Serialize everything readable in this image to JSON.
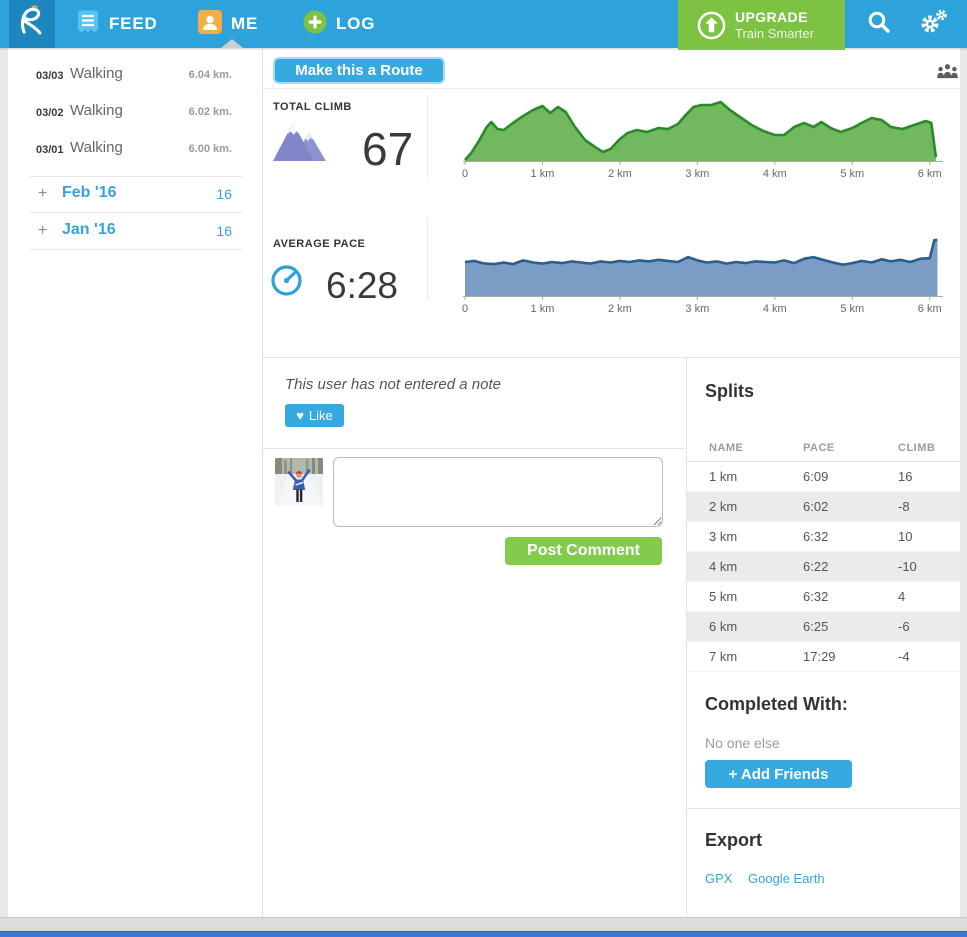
{
  "nav": {
    "brand": "R",
    "items": [
      {
        "label": "FEED",
        "icon": "feed-list-icon"
      },
      {
        "label": "ME",
        "icon": "me-person-icon",
        "active": true
      },
      {
        "label": "LOG",
        "icon": "log-plus-icon"
      }
    ],
    "upgrade": {
      "label": "UPGRADE",
      "sublabel": "Train Smarter"
    }
  },
  "sidebar": {
    "activities": [
      {
        "date": "03/03",
        "type": "Walking",
        "distance": "6.04 km."
      },
      {
        "date": "03/02",
        "type": "Walking",
        "distance": "6.02 km."
      },
      {
        "date": "03/01",
        "type": "Walking",
        "distance": "6.00 km."
      }
    ],
    "months": [
      {
        "expander": "+",
        "label": "Feb '16",
        "count": "16"
      },
      {
        "expander": "+",
        "label": "Jan '16",
        "count": "16"
      }
    ]
  },
  "main": {
    "route_button": "Make this a Route",
    "stats": [
      {
        "label": "TOTAL CLIMB",
        "value": "67"
      },
      {
        "label": "AVERAGE PACE",
        "value": "6:28"
      }
    ],
    "note": "This user has not entered a note",
    "like_button": {
      "heart": "♥",
      "label": "Like"
    },
    "post_comment_button": "Post Comment"
  },
  "splits": {
    "title": "Splits",
    "columns": [
      "NAME",
      "PACE",
      "CLIMB"
    ],
    "rows": [
      [
        "1 km",
        "6:09",
        "16"
      ],
      [
        "2 km",
        "6:02",
        "-8"
      ],
      [
        "3 km",
        "6:32",
        "10"
      ],
      [
        "4 km",
        "6:22",
        "-10"
      ],
      [
        "5 km",
        "6:32",
        "4"
      ],
      [
        "6 km",
        "6:25",
        "-6"
      ],
      [
        "7 km",
        "17:29",
        "-4"
      ]
    ]
  },
  "completed_with": {
    "title": "Completed With:",
    "empty": "No one else",
    "add_button": "+ Add Friends"
  },
  "export": {
    "title": "Export",
    "links": [
      "GPX",
      "Google Earth"
    ]
  },
  "chart_data": [
    {
      "type": "area",
      "name": "elevation-profile",
      "title": "TOTAL CLIMB 67",
      "x_ticks": [
        "0",
        "1 km",
        "2 km",
        "3 km",
        "4 km",
        "5 km",
        "6 km"
      ],
      "x_tick_km": [
        0,
        1,
        2,
        3,
        4,
        5,
        6
      ],
      "xlim_km": [
        0,
        6.12
      ],
      "x_km": [
        0.0,
        0.08,
        0.18,
        0.28,
        0.34,
        0.42,
        0.5,
        0.62,
        0.75,
        0.88,
        1.0,
        1.1,
        1.2,
        1.3,
        1.42,
        1.55,
        1.68,
        1.78,
        1.88,
        2.0,
        2.1,
        2.22,
        2.35,
        2.5,
        2.62,
        2.75,
        2.85,
        2.95,
        3.05,
        3.18,
        3.3,
        3.42,
        3.55,
        3.7,
        3.85,
        4.0,
        4.12,
        4.25,
        4.38,
        4.5,
        4.6,
        4.72,
        4.85,
        5.0,
        5.12,
        5.25,
        5.38,
        5.5,
        5.65,
        5.8,
        5.95,
        6.02,
        6.08
      ],
      "elevation_m": [
        1,
        8,
        20,
        34,
        39,
        32,
        31,
        38,
        45,
        51,
        55,
        48,
        54,
        49,
        34,
        21,
        14,
        9,
        12,
        22,
        28,
        31,
        29,
        33,
        32,
        37,
        46,
        54,
        56,
        56,
        59,
        51,
        44,
        36,
        30,
        26,
        26,
        34,
        38,
        34,
        39,
        33,
        29,
        33,
        38,
        43,
        41,
        34,
        32,
        36,
        40,
        38,
        4
      ],
      "fill": "#72B85E",
      "stroke": "#2B8A2B"
    },
    {
      "type": "area",
      "name": "pace-chart",
      "title": "AVERAGE PACE 6:28",
      "x_ticks": [
        "0",
        "1 km",
        "2 km",
        "3 km",
        "4 km",
        "5 km",
        "6 km"
      ],
      "x_tick_km": [
        0,
        1,
        2,
        3,
        4,
        5,
        6
      ],
      "xlim_km": [
        0,
        6.12
      ],
      "x_km": [
        0.0,
        0.12,
        0.25,
        0.38,
        0.5,
        0.62,
        0.75,
        0.88,
        1.0,
        1.12,
        1.25,
        1.38,
        1.5,
        1.62,
        1.75,
        1.88,
        2.0,
        2.12,
        2.25,
        2.38,
        2.5,
        2.62,
        2.75,
        2.88,
        3.0,
        3.12,
        3.25,
        3.38,
        3.5,
        3.62,
        3.75,
        3.88,
        4.0,
        4.12,
        4.25,
        4.38,
        4.5,
        4.62,
        4.75,
        4.88,
        5.0,
        5.12,
        5.25,
        5.38,
        5.5,
        5.62,
        5.75,
        5.88,
        6.0,
        6.06,
        6.1
      ],
      "pace_min_per_km": [
        6.3,
        6.5,
        6.0,
        5.9,
        6.2,
        5.9,
        6.6,
        6.2,
        6.0,
        6.3,
        6.1,
        6.4,
        6.2,
        6.0,
        6.4,
        6.2,
        6.5,
        6.3,
        6.6,
        6.4,
        6.7,
        6.5,
        6.3,
        7.2,
        6.6,
        6.2,
        6.4,
        6.0,
        6.3,
        6.1,
        6.4,
        6.3,
        6.2,
        6.6,
        6.1,
        6.9,
        7.2,
        6.7,
        6.2,
        5.8,
        6.1,
        6.5,
        6.2,
        6.8,
        6.4,
        6.7,
        6.3,
        6.9,
        7.0,
        10.4,
        17.5
      ],
      "fill": "#7A9CC5",
      "stroke": "#2A5E8E"
    }
  ],
  "colors": {
    "nav_blue": "#2EA3DB",
    "brand_tile_blue": "#1D86BD",
    "accent_blue": "#36A9E1",
    "upgrade_green": "#7DC242",
    "post_green": "#82CB4D",
    "me_orange": "#F2AE43",
    "feed_light_blue": "#55C4EE",
    "mountain_purple": "#8185C9",
    "elevation_fill": "#72B85E",
    "pace_fill": "#7A9CC5",
    "stripe_gray": "#EBEBEB",
    "bottom_bar_blue": "#4078D0"
  }
}
